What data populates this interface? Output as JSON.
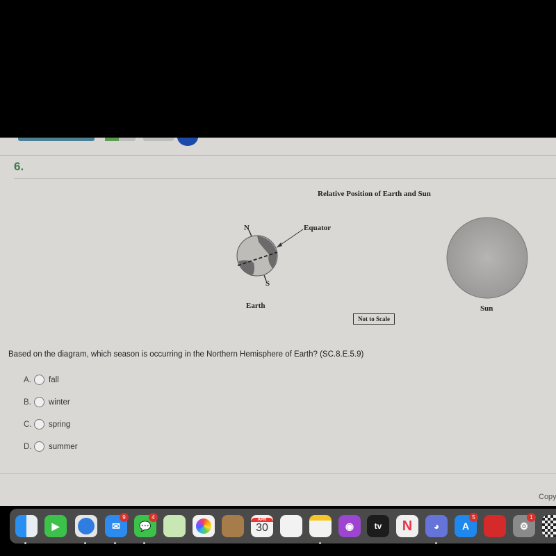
{
  "question": {
    "number": "6.",
    "prompt": "Based on the diagram, which season is occurring in the Northern Hemisphere of Earth? (SC.8.E.5.9)",
    "choices": [
      {
        "letter": "A.",
        "label": "fall"
      },
      {
        "letter": "B.",
        "label": "winter"
      },
      {
        "letter": "C.",
        "label": "spring"
      },
      {
        "letter": "D.",
        "label": "summer"
      }
    ]
  },
  "diagram": {
    "title": "Relative Position of Earth and Sun",
    "north_label": "N",
    "south_label": "S",
    "equator_label": "Equator",
    "earth_label": "Earth",
    "sun_label": "Sun",
    "scale_note": "Not to Scale"
  },
  "footer": {
    "copyright_partial": "Copy"
  },
  "dock": {
    "apps": [
      {
        "name": "Finder",
        "icon": "finder-icon"
      },
      {
        "name": "FaceTime",
        "icon": "facetime-icon"
      },
      {
        "name": "Safari",
        "icon": "safari-icon"
      },
      {
        "name": "Mail",
        "icon": "mail-icon",
        "badge": "9"
      },
      {
        "name": "Messages",
        "icon": "messages-icon",
        "badge": "4"
      },
      {
        "name": "Maps",
        "icon": "maps-icon"
      },
      {
        "name": "Photos",
        "icon": "photos-icon"
      },
      {
        "name": "Contacts",
        "icon": "contacts-icon"
      },
      {
        "name": "Calendar",
        "icon": "calendar-icon",
        "month": "APR",
        "day": "30"
      },
      {
        "name": "Reminders",
        "icon": "reminders-icon"
      },
      {
        "name": "Notes",
        "icon": "notes-icon"
      },
      {
        "name": "Podcasts",
        "icon": "podcasts-icon"
      },
      {
        "name": "TV",
        "icon": "apple-tv-icon",
        "text": "tv"
      },
      {
        "name": "News",
        "icon": "news-icon"
      },
      {
        "name": "Discord",
        "icon": "discord-icon"
      },
      {
        "name": "App Store",
        "icon": "app-store-icon",
        "badge": "5"
      },
      {
        "name": "Photo Booth",
        "icon": "photo-booth-icon"
      },
      {
        "name": "System Preferences",
        "icon": "system-preferences-icon",
        "badge": "1"
      },
      {
        "name": "Chess",
        "icon": "chess-icon"
      }
    ]
  }
}
